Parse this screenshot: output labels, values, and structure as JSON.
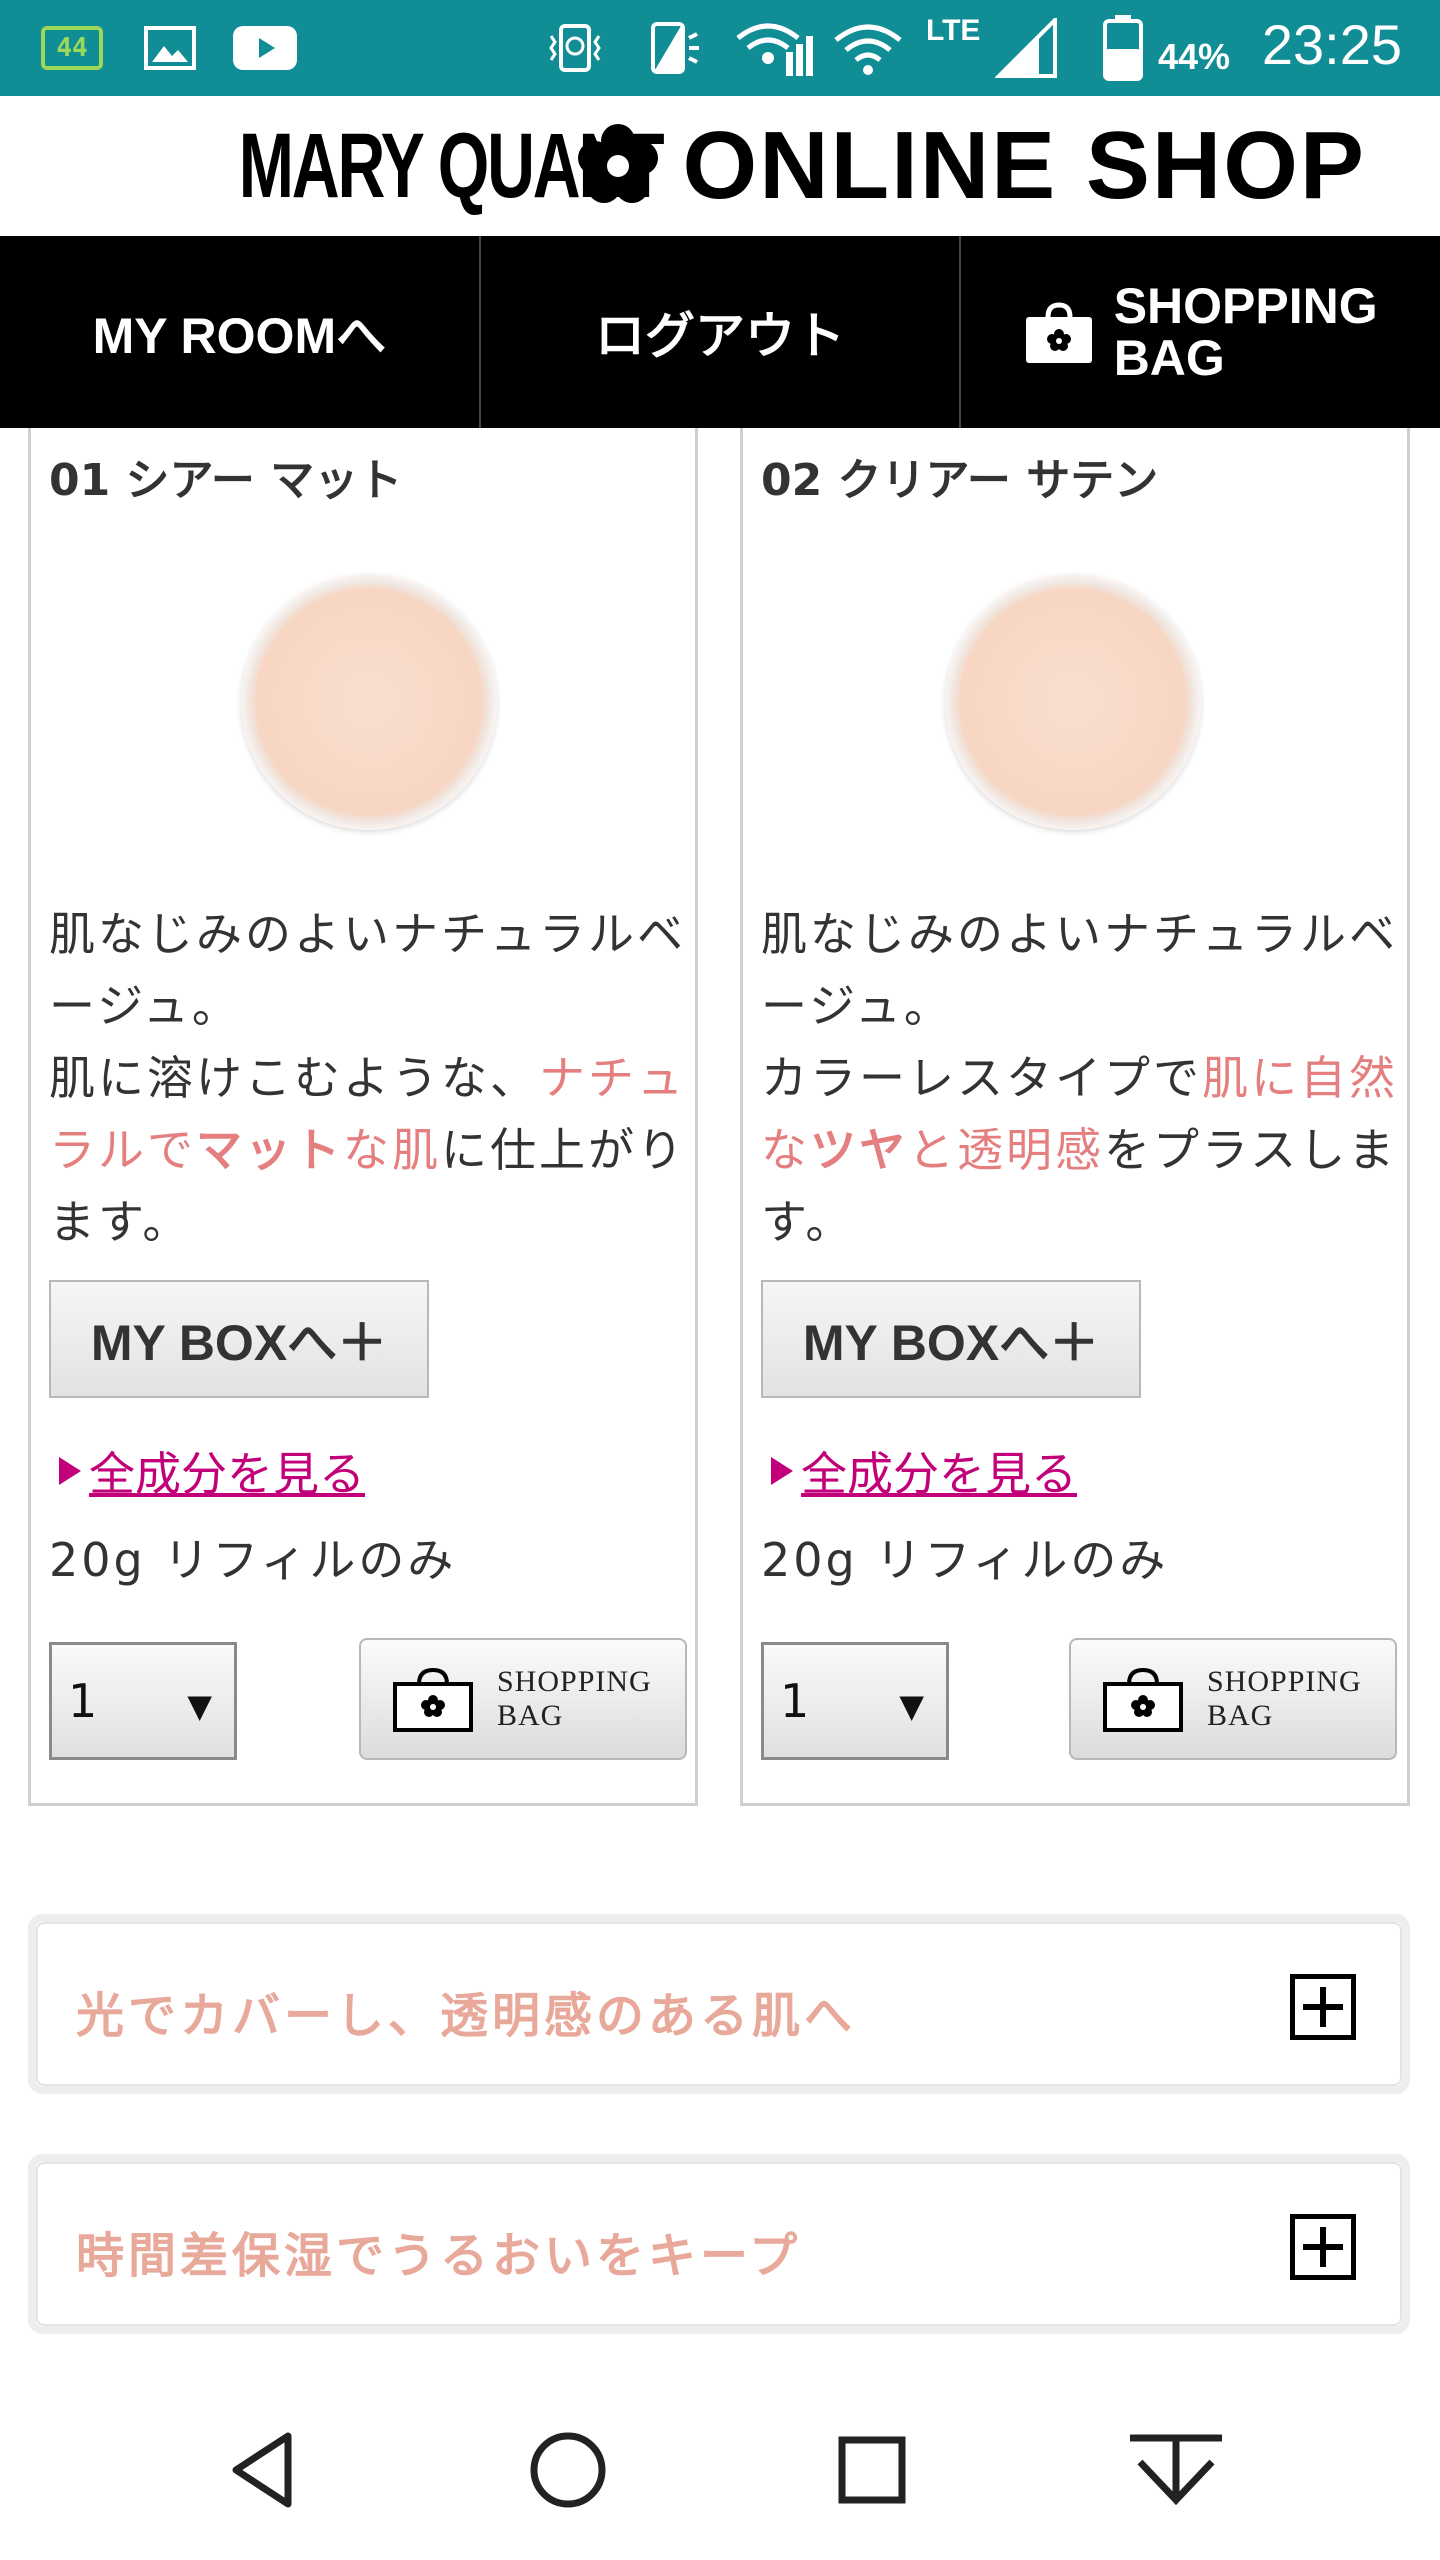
{
  "status_bar": {
    "notification_badge": "44",
    "network_label": "LTE",
    "battery": "44%",
    "time": "23:25",
    "icons": [
      "battery-saver-icon",
      "image-icon",
      "youtube-icon",
      "vibrate-alarm-icon",
      "vibrate-icon",
      "wifi-calling-icon",
      "wifi-icon",
      "lte-signal-icon",
      "battery-icon"
    ]
  },
  "header": {
    "brand": "MARY QUANT",
    "shop": "ONLINE SHOP"
  },
  "nav": {
    "my_room": "MY ROOMへ",
    "logout": "ログアウト",
    "bag_line1": "SHOPPING",
    "bag_line2": "BAG"
  },
  "products": [
    {
      "name": "01 シアー マット",
      "desc_1": "肌なじみのよいナチュラルベージュ。",
      "desc_2": "肌に溶けこむような、",
      "desc_hl1": "ナチュラルで",
      "desc_hl2": "マット",
      "desc_hl3": "な肌",
      "desc_3": "に仕上がります。",
      "mybox": "MY BOXへ＋",
      "ingredients": "全成分を見る",
      "size": "20g リフィルのみ",
      "qty": "1",
      "bag_line1": "SHOPPING",
      "bag_line2": "BAG"
    },
    {
      "name": "02 クリアー サテン",
      "desc_1": "肌なじみのよいナチュラルベージュ。",
      "desc_2": "カラーレスタイプで",
      "desc_hl1": "肌に自然な",
      "desc_hl2": "ツヤ",
      "desc_hl3": "と透明感",
      "desc_3": "をプラスします。",
      "mybox": "MY BOXへ＋",
      "ingredients": "全成分を見る",
      "size": "20g リフィルのみ",
      "qty": "1",
      "bag_line1": "SHOPPING",
      "bag_line2": "BAG"
    }
  ],
  "accordions": [
    {
      "label": "光でカバーし、透明感のある肌へ"
    },
    {
      "label": "時間差保湿でうるおいをキープ"
    }
  ],
  "colors": {
    "status_bar": "#118d96",
    "nav_bg": "#000000",
    "highlight": "#e57f7f",
    "link": "#c2007a",
    "accordion_text": "#e8a89a"
  }
}
